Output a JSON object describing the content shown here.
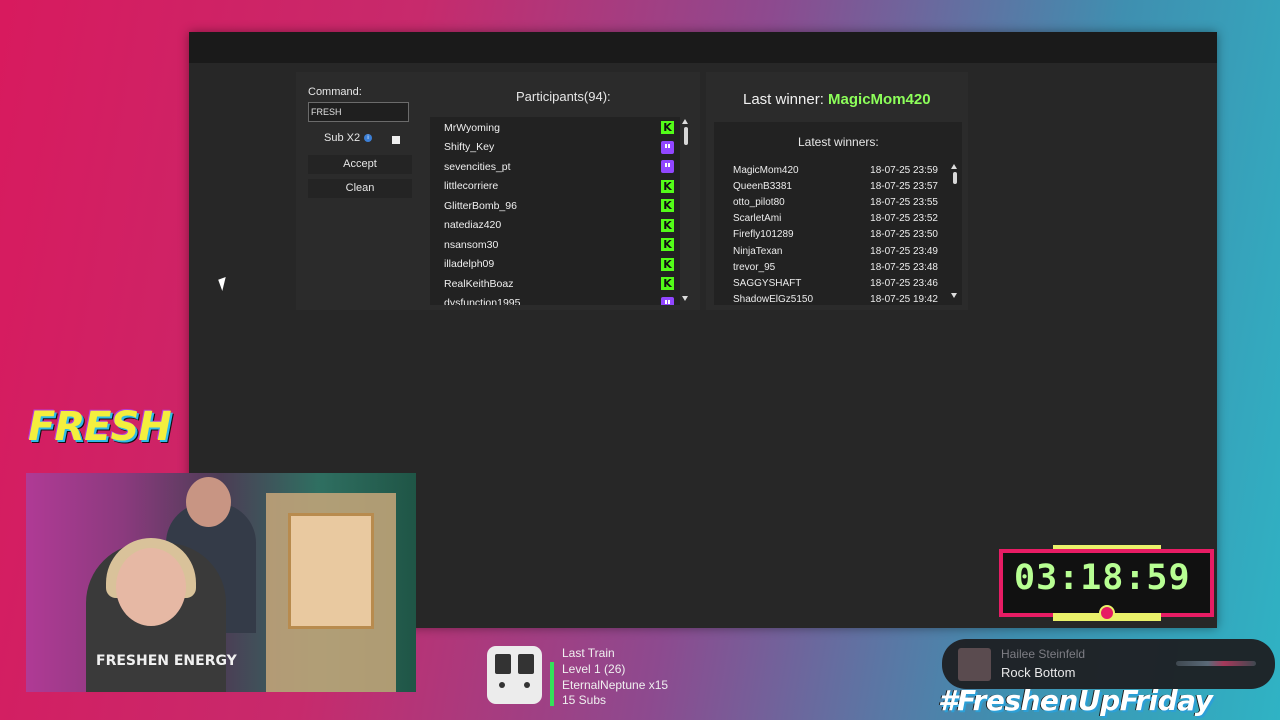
{
  "command": {
    "label": "Command:",
    "value": "FRESH"
  },
  "sub_option": {
    "label": "Sub X2"
  },
  "buttons": {
    "accept": "Accept",
    "clean": "Clean"
  },
  "participants": {
    "title": "Participants(94):",
    "items": [
      {
        "name": "MrWyoming",
        "platform": "kick"
      },
      {
        "name": "Shifty_Key",
        "platform": "twitch"
      },
      {
        "name": "sevencities_pt",
        "platform": "twitch"
      },
      {
        "name": "littlecorriere",
        "platform": "kick"
      },
      {
        "name": "GlitterBomb_96",
        "platform": "kick"
      },
      {
        "name": "natediaz420",
        "platform": "kick"
      },
      {
        "name": "nsansom30",
        "platform": "kick"
      },
      {
        "name": "illadelph09",
        "platform": "kick"
      },
      {
        "name": "RealKeithBoaz",
        "platform": "kick"
      },
      {
        "name": "dysfunction1995",
        "platform": "twitch"
      }
    ]
  },
  "last_winner": {
    "label": "Last winner:",
    "name": "MagicMom420"
  },
  "latest_winners": {
    "title": "Latest winners:",
    "items": [
      {
        "name": "MagicMom420",
        "time": "18-07-25 23:59"
      },
      {
        "name": "QueenB3381",
        "time": "18-07-25 23:57"
      },
      {
        "name": "otto_pilot80",
        "time": "18-07-25 23:55"
      },
      {
        "name": "ScarletAmi",
        "time": "18-07-25 23:52"
      },
      {
        "name": "Firefly101289",
        "time": "18-07-25 23:50"
      },
      {
        "name": "NinjaTexan",
        "time": "18-07-25 23:49"
      },
      {
        "name": "trevor_95",
        "time": "18-07-25 23:48"
      },
      {
        "name": "SAGGYSHAFT",
        "time": "18-07-25 23:46"
      },
      {
        "name": "ShadowElGz5150",
        "time": "18-07-25 19:42"
      }
    ]
  },
  "overlay": {
    "logo_text": "FRESH",
    "webcam_shirt_text": "FRESHEN ENERGY",
    "timer": "03:18:59",
    "train": {
      "title": "Last Train",
      "level": "Level 1  (26)",
      "contributor": "EternalNeptune x15",
      "subs": "15 Subs"
    },
    "now_playing": {
      "artist": "Hailee Steinfeld",
      "title": "Rock Bottom"
    },
    "hashtag": "#FreshenUpFriday"
  },
  "colors": {
    "kick": "#53fc18",
    "twitch": "#9146ff",
    "winner_accent": "#8dff5a",
    "timer_border": "#e71c64",
    "timer_text": "#b8ff93"
  }
}
